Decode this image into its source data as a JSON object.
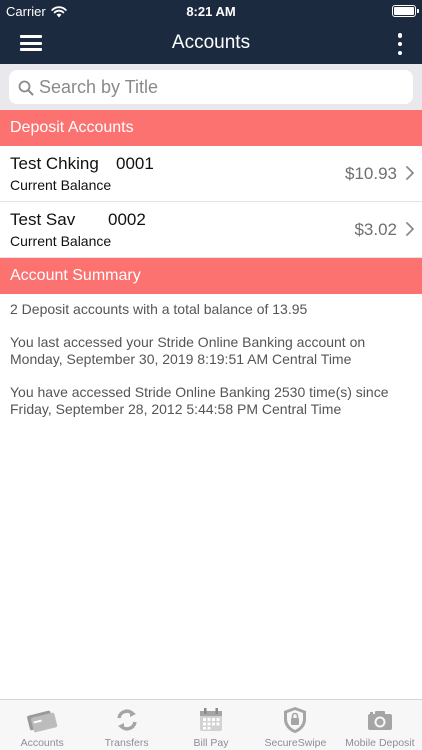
{
  "status_bar": {
    "carrier": "Carrier",
    "time": "8:21 AM",
    "battery_level": 1.0
  },
  "nav": {
    "title": "Accounts"
  },
  "search": {
    "placeholder": "Search by Title",
    "value": ""
  },
  "deposit_section": {
    "header": "Deposit Accounts",
    "accounts": [
      {
        "name": "Test Chking",
        "number": "0001",
        "subtitle": "Current Balance",
        "balance": "$10.93"
      },
      {
        "name": "Test Sav",
        "number": "0002",
        "subtitle": "Current Balance",
        "balance": "$3.02"
      }
    ]
  },
  "summary_section": {
    "header": "Account Summary",
    "lines": [
      "2 Deposit accounts with a total balance of 13.95",
      "You last accessed your Stride Online Banking account on Monday, September 30, 2019 8:19:51 AM Central Time",
      "You have accessed Stride Online Banking 2530 time(s) since Friday, September 28, 2012 5:44:58 PM Central Time"
    ]
  },
  "tab_bar": {
    "tabs": [
      {
        "label": "Accounts",
        "icon": "card-icon"
      },
      {
        "label": "Transfers",
        "icon": "transfer-arrows-icon"
      },
      {
        "label": "Bill Pay",
        "icon": "calendar-icon"
      },
      {
        "label": "SecureSwipe",
        "icon": "lock-shield-icon"
      },
      {
        "label": "Mobile Deposit",
        "icon": "camera-icon"
      }
    ]
  },
  "colors": {
    "nav_background": "#1c2a40",
    "section_header": "#fb7271",
    "search_background": "#e9e9ed",
    "tab_inactive": "#8e8e93"
  }
}
